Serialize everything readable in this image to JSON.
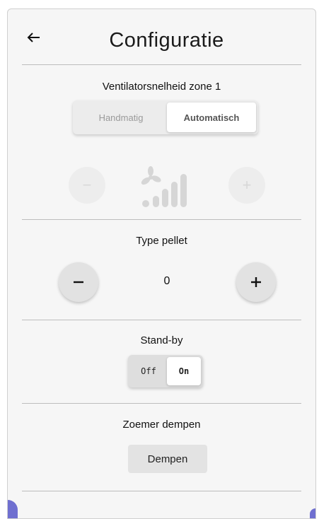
{
  "header": {
    "title": "Configuratie",
    "back_icon": "arrow-left-icon"
  },
  "fan_speed": {
    "label": "Ventilatorsnelheid zone 1",
    "modes": [
      "Handmatig",
      "Automatisch"
    ],
    "selected_mode": "Automatisch",
    "decrease_symbol": "−",
    "increase_symbol": "+",
    "fan_icon": "fan-speed-icon"
  },
  "pellet_type": {
    "label": "Type pellet",
    "value": "0",
    "decrease_icon": "minus-icon",
    "increase_icon": "plus-icon"
  },
  "standby": {
    "label": "Stand-by",
    "options": [
      "Off",
      "On"
    ],
    "selected": "On"
  },
  "buzzer": {
    "label": "Zoemer dempen",
    "button_label": "Dempen"
  },
  "colors": {
    "background": "#f6f6f6",
    "divider": "#bdbdbd",
    "accent_corner": "#6f6fd0",
    "disabled": "#d8d8d8"
  }
}
